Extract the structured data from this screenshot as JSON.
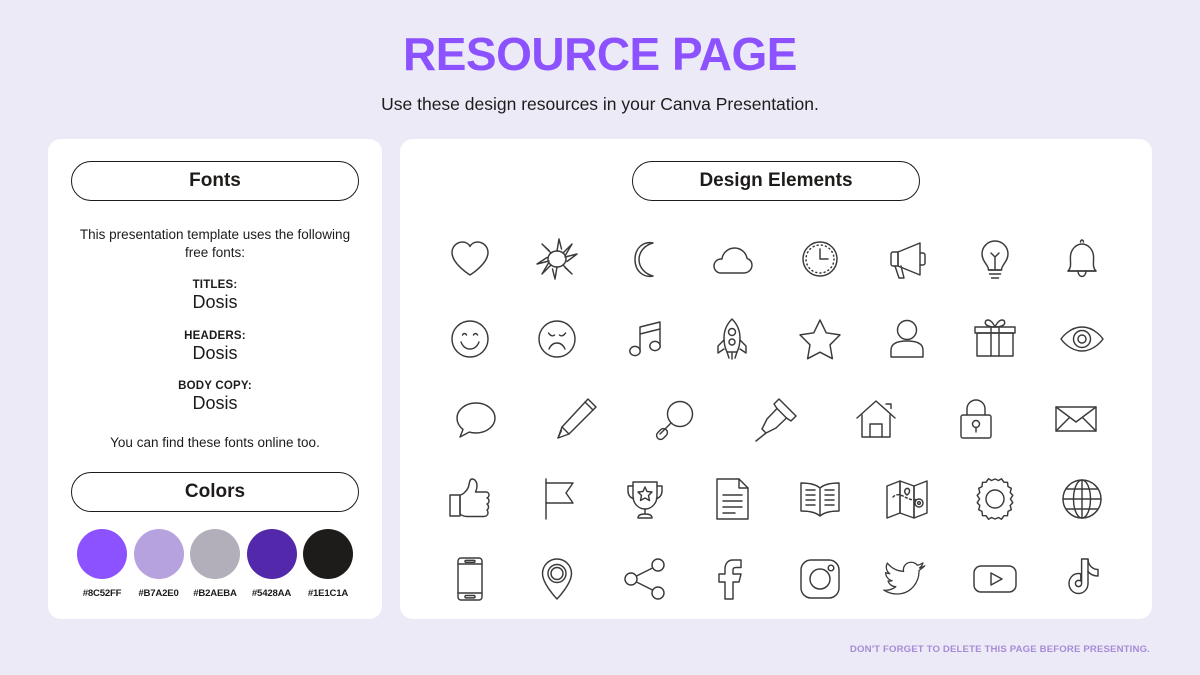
{
  "header": {
    "title": "RESOURCE PAGE",
    "subtitle": "Use these design resources in your Canva Presentation."
  },
  "fonts_panel": {
    "heading": "Fonts",
    "intro": "This presentation template uses the following free fonts:",
    "entries": [
      {
        "role": "TITLES:",
        "name": "Dosis"
      },
      {
        "role": "HEADERS:",
        "name": "Dosis"
      },
      {
        "role": "BODY COPY:",
        "name": "Dosis"
      }
    ],
    "outro": "You can find these fonts online too."
  },
  "colors_panel": {
    "heading": "Colors",
    "swatches": [
      {
        "hex": "#8C52FF"
      },
      {
        "hex": "#B7A2E0"
      },
      {
        "hex": "#B2AEBA"
      },
      {
        "hex": "#5428AA"
      },
      {
        "hex": "#1E1C1A"
      }
    ]
  },
  "elements_panel": {
    "heading": "Design Elements",
    "rows": [
      [
        {
          "icon": "heart-icon"
        },
        {
          "icon": "sun-icon"
        },
        {
          "icon": "moon-icon"
        },
        {
          "icon": "cloud-icon"
        },
        {
          "icon": "clock-icon"
        },
        {
          "icon": "megaphone-icon"
        },
        {
          "icon": "lightbulb-icon"
        },
        {
          "icon": "bell-icon"
        }
      ],
      [
        {
          "icon": "smiley-face-icon"
        },
        {
          "icon": "sad-face-icon"
        },
        {
          "icon": "music-note-icon"
        },
        {
          "icon": "rocket-icon"
        },
        {
          "icon": "star-icon"
        },
        {
          "icon": "person-icon"
        },
        {
          "icon": "gift-icon"
        },
        {
          "icon": "eye-icon"
        }
      ],
      [
        {
          "icon": "speech-bubble-icon"
        },
        {
          "icon": "pencil-icon"
        },
        {
          "icon": "magnifier-icon"
        },
        {
          "icon": "pushpin-icon"
        },
        {
          "icon": "house-icon"
        },
        {
          "icon": "lock-icon"
        },
        {
          "icon": "envelope-icon"
        }
      ],
      [
        {
          "icon": "thumbs-up-icon"
        },
        {
          "icon": "flag-icon"
        },
        {
          "icon": "trophy-icon"
        },
        {
          "icon": "document-icon"
        },
        {
          "icon": "open-book-icon"
        },
        {
          "icon": "map-icon"
        },
        {
          "icon": "gear-icon"
        },
        {
          "icon": "globe-icon"
        }
      ],
      [
        {
          "icon": "phone-icon"
        },
        {
          "icon": "location-pin-icon"
        },
        {
          "icon": "share-icon"
        },
        {
          "icon": "facebook-icon"
        },
        {
          "icon": "instagram-icon"
        },
        {
          "icon": "twitter-icon"
        },
        {
          "icon": "youtube-icon"
        },
        {
          "icon": "tiktok-icon"
        }
      ]
    ]
  },
  "footer": {
    "note": "DON'T FORGET TO DELETE THIS PAGE BEFORE PRESENTING."
  }
}
